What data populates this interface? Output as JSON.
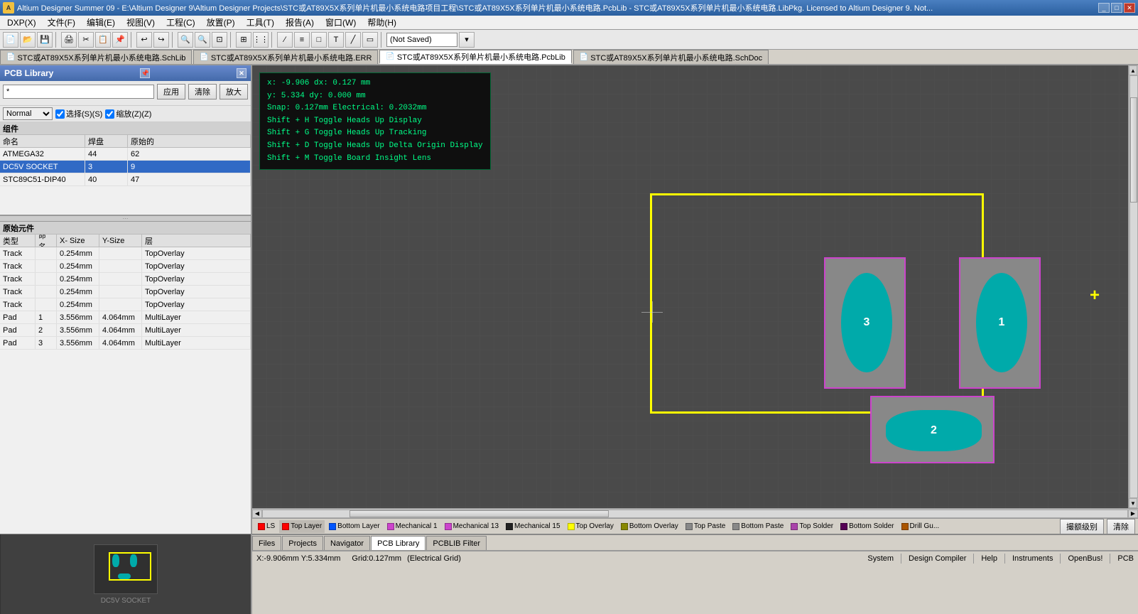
{
  "window": {
    "title": "Altium Designer Summer 09 - E:\\Altium Designer 9\\Altium Designer Projects\\STC或AT89X5X系列单片机最小系统电路项目工程\\STC或AT89X5X系列单片机最小系统电路.PcbLib - STC或AT89X5X系列单片机最小系统电路.LibPkg. Licensed to Altium Designer 9. Not...",
    "icon": "A"
  },
  "menubar": {
    "items": [
      "DXP(X)",
      "文件(F)",
      "编辑(E)",
      "视图(V)",
      "工程(C)",
      "放置(P)",
      "工具(T)",
      "报告(A)",
      "窗口(W)",
      "帮助(H)"
    ]
  },
  "toolbar": {
    "not_saved": "(Not Saved)"
  },
  "tabs": [
    {
      "id": "tab1",
      "label": "STC或AT89X5X系列单片机最小系统电路.SchLib",
      "icon": "📄"
    },
    {
      "id": "tab2",
      "label": "STC或AT89X5X系列单片机最小系统电路.ERR",
      "icon": "📄"
    },
    {
      "id": "tab3",
      "label": "STC或AT89X5X系列单片机最小系统电路.PcbLib",
      "icon": "📄",
      "active": true
    },
    {
      "id": "tab4",
      "label": "STC或AT89X5X系列单片机最小系统电路.SchDoc",
      "icon": "📄"
    }
  ],
  "left_panel": {
    "title": "PCB Library",
    "search_placeholder": "*",
    "buttons": {
      "apply": "应用",
      "clear": "清除",
      "zoom": "放大"
    },
    "mode": "Normal",
    "checkboxes": {
      "select": "选择(S)(S)",
      "zoom2": "缩放(Z)(Z)"
    },
    "component_section": {
      "title": "组件",
      "headers": [
        "命名",
        "焊盘",
        "原始的"
      ],
      "col_widths": [
        "120px",
        "60px",
        "80px"
      ],
      "rows": [
        {
          "name": "ATMEGA32",
          "pads": "44",
          "primitives": "62"
        },
        {
          "name": "DC5V SOCKET",
          "pads": "3",
          "primitives": "9",
          "selected": true
        },
        {
          "name": "STC89C51-DIP40",
          "pads": "40",
          "primitives": "47"
        }
      ]
    },
    "primitive_section": {
      "title": "原始元件",
      "headers": [
        "类型",
        "命名",
        "X- Size",
        "Y-Size",
        "层"
      ],
      "col_widths": [
        "50px",
        "30px",
        "60px",
        "60px",
        "90px"
      ],
      "rows": [
        {
          "type": "Track",
          "name": "",
          "xsize": "0.254mm",
          "ysize": "",
          "layer": "TopOverlay"
        },
        {
          "type": "Track",
          "name": "",
          "xsize": "0.254mm",
          "ysize": "",
          "layer": "TopOverlay"
        },
        {
          "type": "Track",
          "name": "",
          "xsize": "0.254mm",
          "ysize": "",
          "layer": "TopOverlay"
        },
        {
          "type": "Track",
          "name": "",
          "xsize": "0.254mm",
          "ysize": "",
          "layer": "TopOverlay"
        },
        {
          "type": "Track",
          "name": "",
          "xsize": "0.254mm",
          "ysize": "",
          "layer": "TopOverlay"
        },
        {
          "type": "Pad",
          "name": "1",
          "xsize": "3.556mm",
          "ysize": "4.064mm",
          "layer": "MultiLayer"
        },
        {
          "type": "Pad",
          "name": "2",
          "xsize": "3.556mm",
          "ysize": "4.064mm",
          "layer": "MultiLayer"
        },
        {
          "type": "Pad",
          "name": "3",
          "xsize": "3.556mm",
          "ysize": "4.064mm",
          "layer": "MultiLayer"
        }
      ]
    }
  },
  "tooltip": {
    "line1": "x: -9.906   dx:  0.127  mm",
    "line2": "y:  5.334   dy:  0.000  mm",
    "line3": "Snap: 0.127mm Electrical: 0.2032mm",
    "line4": "Shift + H  Toggle Heads Up Display",
    "line5": "Shift + G  Toggle Heads Up Tracking",
    "line6": "Shift + D  Toggle Heads Up Delta Origin Display",
    "line7": "Shift + M  Toggle Board Insight Lens"
  },
  "layer_bar": {
    "items": [
      {
        "id": "ls",
        "label": "LS",
        "color": "#ff0000",
        "active": false
      },
      {
        "id": "top-layer",
        "label": "Top Layer",
        "color": "#ff0000",
        "active": true
      },
      {
        "id": "bottom-layer",
        "label": "Bottom Layer",
        "color": "#0000ff"
      },
      {
        "id": "mechanical1",
        "label": "Mechanical 1",
        "color": "#cc44cc"
      },
      {
        "id": "mechanical13",
        "label": "Mechanical 13",
        "color": "#cc44cc"
      },
      {
        "id": "mechanical15",
        "label": "Mechanical 15",
        "color": "#000000"
      },
      {
        "id": "top-overlay",
        "label": "Top Overlay",
        "color": "#ffff00"
      },
      {
        "id": "bottom-overlay",
        "label": "Bottom Overlay",
        "color": "#888800"
      },
      {
        "id": "top-paste",
        "label": "Top Paste",
        "color": "#888888"
      },
      {
        "id": "bottom-paste",
        "label": "Bottom Paste",
        "color": "#888888"
      },
      {
        "id": "top-solder",
        "label": "Top Solder",
        "color": "#aa44aa"
      },
      {
        "id": "bottom-solder",
        "label": "Bottom Solder",
        "color": "#550055"
      },
      {
        "id": "drill-guide",
        "label": "Drill Gu...",
        "color": "#aa5500"
      }
    ],
    "right_buttons": [
      "撮额级别",
      "清除"
    ]
  },
  "statusbar": {
    "coord": "X:-9.906mm Y:5.334mm",
    "grid": "Grid:0.127mm",
    "mode": "(Electrical Grid)",
    "right": {
      "system": "System",
      "design_compiler": "Design Compiler",
      "help": "Help",
      "instruments": "Instruments",
      "open_bus": "OpenBus!",
      "pcb": "PCB"
    }
  },
  "bottom_tabs": [
    {
      "id": "files",
      "label": "Files"
    },
    {
      "id": "projects",
      "label": "Projects"
    },
    {
      "id": "navigator",
      "label": "Navigator"
    },
    {
      "id": "pcb-library",
      "label": "PCB Library",
      "active": true
    },
    {
      "id": "pcblib-filter",
      "label": "PCBLIB Filter"
    }
  ]
}
